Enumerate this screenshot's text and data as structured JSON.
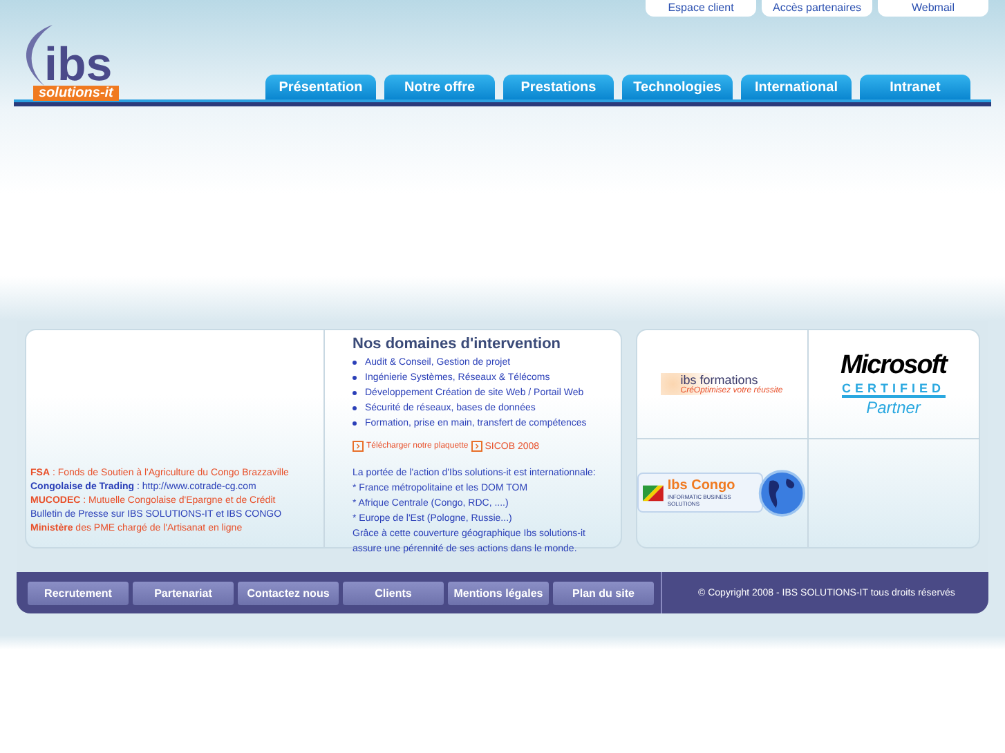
{
  "top_links": [
    "Espace client",
    "Accès partenaires",
    "Webmail"
  ],
  "logo": {
    "name": "ibs",
    "tagline": "solutions-it"
  },
  "nav": [
    "Présentation",
    "Notre offre",
    "Prestations",
    "Technologies",
    "International",
    "Intranet"
  ],
  "news": [
    {
      "text": "**FSA** : Fonds de Soutien à l'Agriculture du Congo Brazzaville",
      "color": "#e8502a"
    },
    {
      "text": "**Congolaise de Trading** : http://www.cotrade-cg.com",
      "color": "#2a3fb8"
    },
    {
      "text": "**MUCODEC** : Mutuelle Congolaise d'Epargne et de Crédit",
      "color": "#e8502a"
    },
    {
      "text": "Bulletin de Presse sur IBS SOLUTIONS-IT et IBS CONGO",
      "color": "#2a3fb8"
    },
    {
      "text": "**Ministère** des PME chargé de l'Artisanat en ligne",
      "color": "#e8502a"
    }
  ],
  "domains": {
    "title": "Nos domaines d'intervention",
    "items": [
      "Audit & Conseil, Gestion de projet",
      "Ingénierie Systèmes, Réseaux & Télécoms",
      "Développement Création de site Web / Portail Web",
      "Sécurité de réseaux, bases de données",
      "Formation, prise en main, transfert de compétences"
    ],
    "downloads": [
      "Télécharger notre plaquette",
      "SICOB 2008"
    ],
    "paragraph": [
      "La portée de l'action d'Ibs solutions-it est internationnale:",
      "* France métropolitaine et les DOM TOM",
      "* Afrique Centrale (Congo, RDC, ....)",
      "* Europe de l'Est (Pologne, Russie...)",
      "Grâce à cette couverture géographique Ibs solutions-it assure une pérennité de ses actions dans le monde."
    ]
  },
  "partners": [
    {
      "kind": "formations",
      "name": "ibs formations",
      "tagline": "CréOptimisez votre réussite"
    },
    {
      "kind": "microsoft",
      "name": "Microsoft",
      "line2": "CERTIFIED",
      "line3": "Partner"
    },
    {
      "kind": "congo",
      "name": "Ibs Congo",
      "tagline": "INFORMATIC BUSINESS SOLUTIONS"
    }
  ],
  "footer_links": [
    "Recrutement",
    "Partenariat",
    "Contactez nous",
    "Clients",
    "Mentions légales",
    "Plan du site"
  ],
  "copyright": "© Copyright 2008 - IBS SOLUTIONS-IT tous droits réservés"
}
